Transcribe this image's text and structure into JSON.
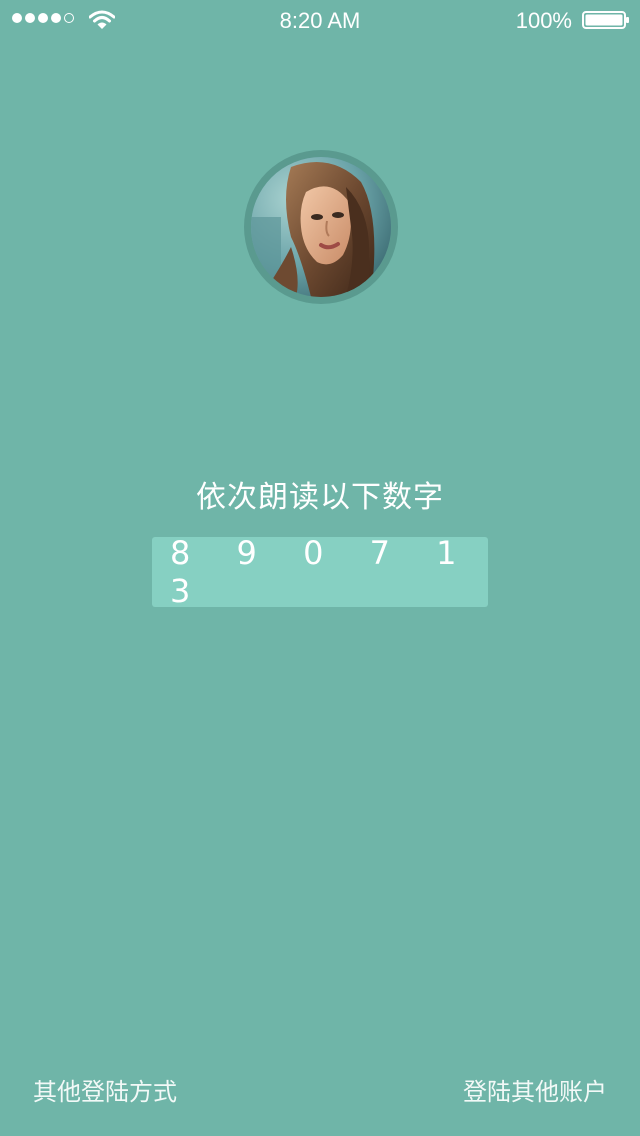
{
  "status_bar": {
    "time": "8:20 AM",
    "battery_percent": "100%",
    "signal_bars_filled": 4,
    "signal_bars_total": 5,
    "battery_level": 1.0
  },
  "colors": {
    "background": "#6fb5a8",
    "code_box": "#86d0c2",
    "avatar_ring": "#5a9a8f",
    "text": "#ffffff"
  },
  "main": {
    "instruction": "依次朗读以下数字",
    "code": "8 9 0 7 1 3"
  },
  "footer": {
    "other_login_methods": "其他登陆方式",
    "login_other_account": "登陆其他账户"
  }
}
